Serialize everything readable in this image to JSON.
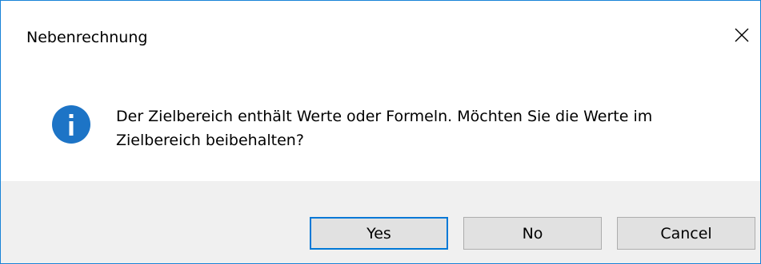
{
  "window": {
    "title": "Nebenrechnung"
  },
  "message": {
    "text": "Der Zielbereich enthält Werte oder Formeln. Möchten Sie die Werte im Zielbereich beibehalten?",
    "icon": "info-icon"
  },
  "buttons": {
    "yes_label": "Yes",
    "no_label": "No",
    "cancel_label": "Cancel"
  },
  "colors": {
    "border": "#1883d7",
    "icon": "#1d74c6",
    "footer": "#f0f0f0",
    "button": "#e1e1e1",
    "default_button_border": "#0078d7"
  }
}
